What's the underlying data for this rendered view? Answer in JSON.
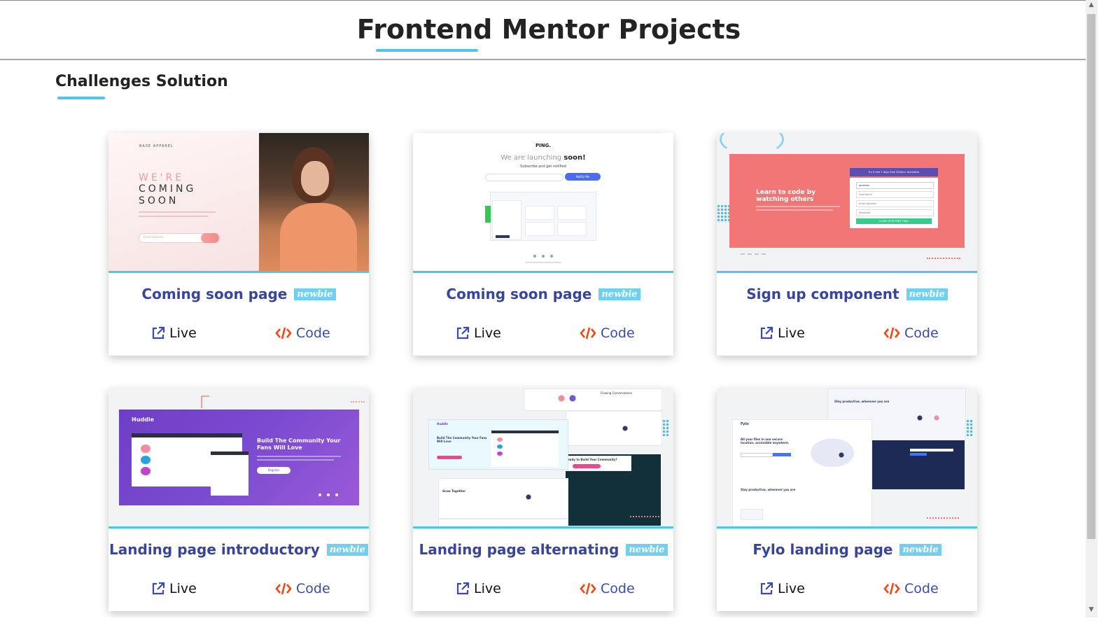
{
  "header": {
    "title": "Frontend Mentor Projects"
  },
  "section": {
    "title": "Challenges Solution"
  },
  "cards": [
    {
      "title": "Coming soon page",
      "badge": "newbie",
      "live_label": "Live",
      "code_label": "Code",
      "thumb": {
        "logo": "BASE APPAREL",
        "line1": "WE'RE",
        "line2": "COMING",
        "line3": "SOON",
        "input_placeholder": "Email Address"
      }
    },
    {
      "title": "Coming soon page",
      "badge": "newbie",
      "live_label": "Live",
      "code_label": "Code",
      "thumb": {
        "logo": "PING.",
        "headline_a": "We are launching ",
        "headline_b": "soon!",
        "sub": "Subscribe and get notified",
        "button": "Notify Me"
      }
    },
    {
      "title": "Sign up component",
      "badge": "newbie",
      "live_label": "Live",
      "code_label": "Code",
      "thumb": {
        "headline": "Learn to code by watching others",
        "banner": "Try it free 7 days then $20/mo. thereafter",
        "field1": "Jonathan",
        "field2": "Last Name",
        "field3": "Email Address",
        "field4": "Password",
        "button": "CLAIM YOUR FREE TRIAL"
      }
    },
    {
      "title": "Landing page introductory",
      "badge": "newbie",
      "live_label": "Live",
      "code_label": "Code",
      "thumb": {
        "logo": "Huddle",
        "headline": "Build The Community Your Fans Will Love",
        "button": "Register"
      }
    },
    {
      "title": "Landing page alternating",
      "badge": "newbie",
      "live_label": "Live",
      "code_label": "Code",
      "thumb": {
        "logo": "Huddle",
        "headline": "Build The Community Your Fans Will Love",
        "card_a": "Flowing Conversations",
        "card_b": "Grow Together",
        "cta": "Ready to Build Your Community?"
      }
    },
    {
      "title": "Fylo landing page",
      "badge": "newbie",
      "live_label": "Live",
      "code_label": "Code",
      "thumb": {
        "logo": "Fylo",
        "headline": "All your files in one secure location, accessible anywhere.",
        "sub": "Stay productive, wherever you are"
      }
    }
  ],
  "colors": {
    "accent": "#4ec6ea",
    "title_blue": "#37459b",
    "code_orange": "#f04a14",
    "badge": "#6fd0ef"
  },
  "icons": {
    "live": "external-link-icon",
    "code": "code-icon"
  }
}
